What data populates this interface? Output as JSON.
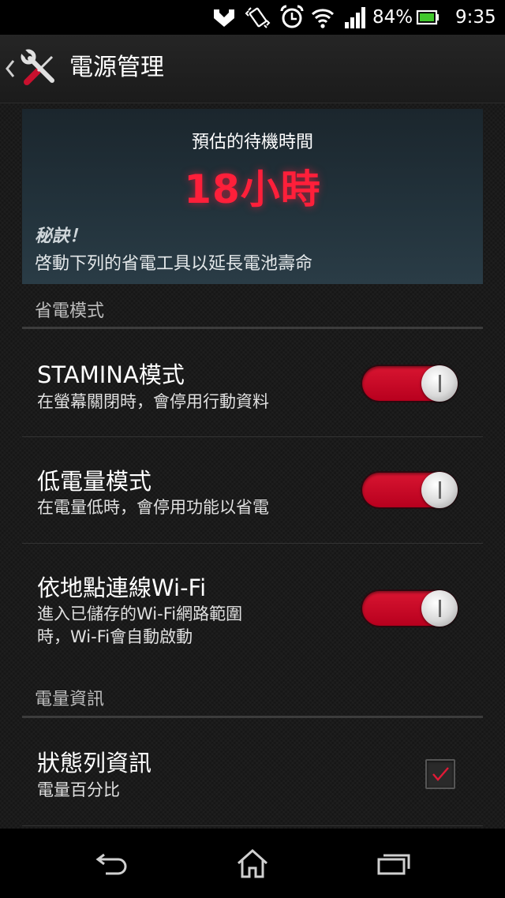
{
  "status_bar": {
    "battery_percent": "84%",
    "time": "9:35",
    "icons": [
      "nfc-icon",
      "vibrate-icon",
      "alarm-icon",
      "wifi-icon",
      "signal-icon",
      "battery-icon"
    ]
  },
  "header": {
    "title": "電源管理",
    "icon": "tools-icon"
  },
  "banner": {
    "label": "預估的待機時間",
    "value": "18小時",
    "tip_title": "秘訣！",
    "tip_text": "啓動下列的省電工具以延長電池壽命"
  },
  "sections": {
    "power_saving": {
      "header": "省電模式",
      "items": [
        {
          "title": "STAMINA模式",
          "subtitle": "在螢幕關閉時，會停用行動資料",
          "enabled": true
        },
        {
          "title": "低電量模式",
          "subtitle": "在電量低時，會停用功能以省電",
          "enabled": true
        },
        {
          "title": "依地點連線Wi-Fi",
          "subtitle_line1": "進入已儲存的Wi-Fi網路範圍",
          "subtitle_line2": "時，Wi-Fi會自動啟動",
          "enabled": true
        }
      ]
    },
    "battery_info": {
      "header": "電量資訊",
      "items": [
        {
          "title": "狀態列資訊",
          "subtitle": "電量百分比",
          "checked": true
        }
      ]
    }
  },
  "nav_bar": {
    "buttons": [
      "back-icon",
      "home-icon",
      "recent-apps-icon"
    ]
  },
  "colors": {
    "accent": "#d81531",
    "standby_value": "#ff1f3a",
    "background": "#161616"
  }
}
